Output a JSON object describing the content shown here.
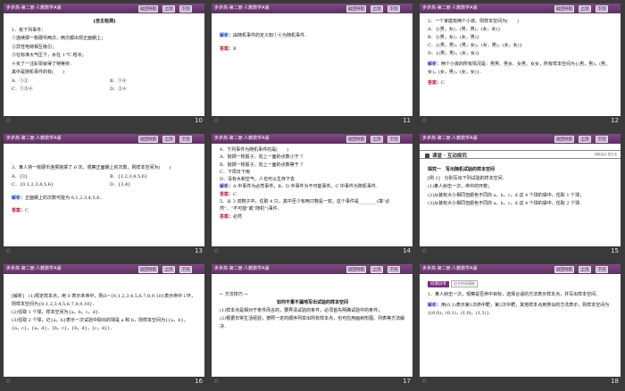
{
  "header": {
    "title": "步步高·第二册·人教数学A版",
    "nav_back": "返回导航",
    "nav_prev": "上页",
    "nav_next": "下页"
  },
  "footer_icon": "star-icon",
  "slides": [
    {
      "page": "10",
      "title": "[自主检测]",
      "lines": [
        "1．有下列事件：",
        "①连续掷一枚硬币两次，两次都出现正面朝上；",
        "②异性电荷相互吸引；",
        "③在标准大气压下，水在 1 ℃ 结冰；",
        "④买了一注彩票就得了特等奖．",
        "其中是随机事件的有(　　)"
      ],
      "options": [
        [
          "A．①②",
          "B．①④"
        ],
        [
          "C．①③④",
          "D．②④"
        ]
      ]
    },
    {
      "page": "11",
      "analysis_label": "解析：",
      "analysis": "由随机事件的定义知①④为随机事件．",
      "answer_label": "答案：",
      "answer": "B"
    },
    {
      "page": "12",
      "lines": [
        "2．一个家庭有两个小孩，则样本空间为(　　)",
        "A．{(男，女)，(男，男)，(女，女)}",
        "B．{(男，女)，(女，男)}",
        "C．{(男，男)，(男，女)，(女，男)，(女，女)}",
        "D．{(男，男)，(女，女)}"
      ],
      "analysis_label": "解析：",
      "analysis": "两个小孩的所有情况是：男男、男女、女男、女女，所有样本空间为{(男，男)，(男，女)，(女，男)，(女，女)}．",
      "answer_label": "答案：",
      "answer": "C"
    },
    {
      "page": "13",
      "lines": [
        "3．某人将一枚硬币连掷抛掷了 6 次，观察正面朝上的次数，则样本空间为(　　)"
      ],
      "options": [
        [
          "A．{3}",
          "B．{1,2,3,4,5,6}"
        ],
        [
          "C．{0,1,2,3,4,5,6}",
          "D．{3,4}"
        ]
      ],
      "analysis_label": "解析：",
      "analysis": "正面朝上的次数可能为 0,1,2,3,4,5,6．",
      "answer_label": "答案：",
      "answer": "C"
    },
    {
      "page": "14",
      "lines": [
        "4．下列事件为随机事件的是(　　)",
        "A．抛掷一枚骰子，向上一面的点数小于 7",
        "B．抛掷一枚骰子，向上一面的点数等于 7",
        "C．下周日下雨",
        "D．没有水和空气，人也可以生存下去"
      ],
      "analysis_label": "解析：",
      "analysis": "A 中事件为必然事件，B、D 中事件为不可能事件，C 中事件为随机事件．",
      "answer_label": "答案：",
      "answer": "C",
      "q5": "5．从 3 双鞋子中，任取 4 只，其中至少有两只鞋是一双，这个事件是________(填“必然”、“不可能”或“随机”)事件．",
      "answer2_label": "答案：",
      "answer2": "必然"
    },
    {
      "page": "15",
      "banner_title": "课堂 · 互动探究",
      "banner_right": "讲练结合  悟方法",
      "lines": [
        "探究一　写出随机试验的样本空间",
        "[例 1]　分别写出下列试验的样本空间．",
        "(1)某人射击一次，命中的环数；",
        "(2)从装有大小相同但颜色不同的 a，b，c，d 这 4 个球的袋中，任取 1 个球；",
        "(3)从装有大小相同但颜色不同的 a，b，c，d 这 4 个球的袋中，任取 2 个球．"
      ]
    },
    {
      "page": "16",
      "lines": [
        "[解析]　(1)规定样本点，用 0 表示未命中，则Ω={0,1,2,3,4,5,6,7,8,9,10}表示命中 i 环，则样本空间为{0,1,2,3,4,5,6,7,8,9,10}．",
        "(2)任取 1 个球，样本空间为{a，b，c，d}．",
        "(3)任取 2 个球，记{a，b}表示一次试验中取出的球是 a 和 b，则样本空间为{{a，b}，{a，c}，{a，d}，{b，c}，{b，d}，{c，d}}．"
      ]
    },
    {
      "page": "17",
      "method_label": "方法技巧",
      "heading": "如何不重不漏地写出试验的样本空间",
      "lines": [
        "(1)样本点是相对于条件而言的，要弄清试验的条件，必须首先明确试验中的条件；",
        "(2)根据日常生活经验，按照一定的顺序列举出所有样本点，也可应用画树形图、列表等方法解决．"
      ]
    },
    {
      "page": "18",
      "tag": "同源异考",
      "tag2": "自主检测演练",
      "lines": [
        "1．某人射击一次，观察是否命中目标，选择合适的方法表示样本点，并写出样本空间．"
      ],
      "analysis_label": "解析：",
      "analysis": "用(0,1)表示第1次命中靶，第2次中靶，其他样本点用类似的方法表示，则样本空间为{(0,0)，(0,1)，(1,0)，(1,1)}．"
    }
  ]
}
